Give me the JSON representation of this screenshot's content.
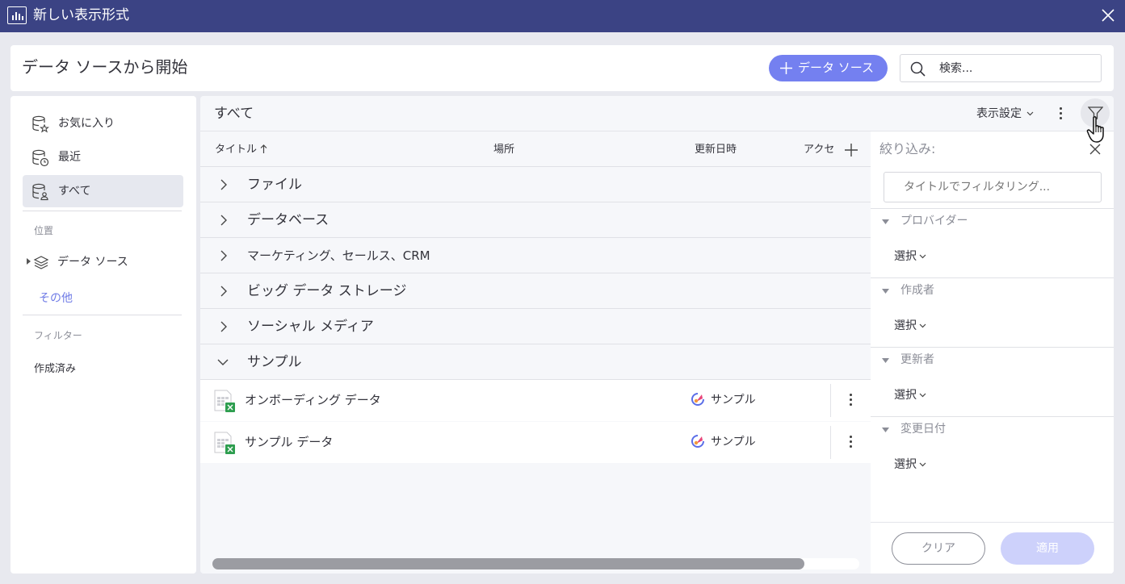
{
  "window": {
    "title": "新しい表示形式",
    "close_icon": "close-icon",
    "app_icon": "chart-bars-icon"
  },
  "header": {
    "title": "データ ソースから開始",
    "add_datasource_label": "データ ソース",
    "search_placeholder": "検索..."
  },
  "sidebar": {
    "items": [
      {
        "label": "お気に入り",
        "icon": "database-star-icon"
      },
      {
        "label": "最近",
        "icon": "database-clock-icon"
      },
      {
        "label": "すべて",
        "icon": "database-user-icon",
        "selected": true
      }
    ],
    "location_header": "位置",
    "datasource_label": "データ ソース",
    "other_label": "その他",
    "filter_header": "フィルター",
    "created_label": "作成済み"
  },
  "main": {
    "title": "すべて",
    "view_settings_label": "表示設定",
    "columns": [
      "タイトル",
      "場所",
      "更新日時",
      "アクセ"
    ],
    "groups": [
      {
        "label": "ファイル",
        "expanded": false
      },
      {
        "label": "データベース",
        "expanded": false
      },
      {
        "label": "マーケティング、セールス、CRM",
        "expanded": false
      },
      {
        "label": "ビッグ データ ストレージ",
        "expanded": false
      },
      {
        "label": "ソーシャル メディア",
        "expanded": false
      },
      {
        "label": "サンプル",
        "expanded": true
      }
    ],
    "files": [
      {
        "name": "オンボーディング データ",
        "location": "サンプル"
      },
      {
        "name": "サンプル データ",
        "location": "サンプル"
      }
    ]
  },
  "filter_panel": {
    "title": "絞り込み:",
    "input_placeholder": "タイトルでフィルタリング...",
    "sections": [
      {
        "label": "プロバイダー",
        "select_label": "選択"
      },
      {
        "label": "作成者",
        "select_label": "選択"
      },
      {
        "label": "更新者",
        "select_label": "選択"
      },
      {
        "label": "変更日付",
        "select_label": "選択"
      }
    ],
    "clear_label": "クリア",
    "apply_label": "適用"
  },
  "colors": {
    "titlebar": "#3b4384",
    "accent": "#7480f0",
    "selected_nav": "#e6e8ef",
    "excel_green": "#2e9e4f"
  }
}
